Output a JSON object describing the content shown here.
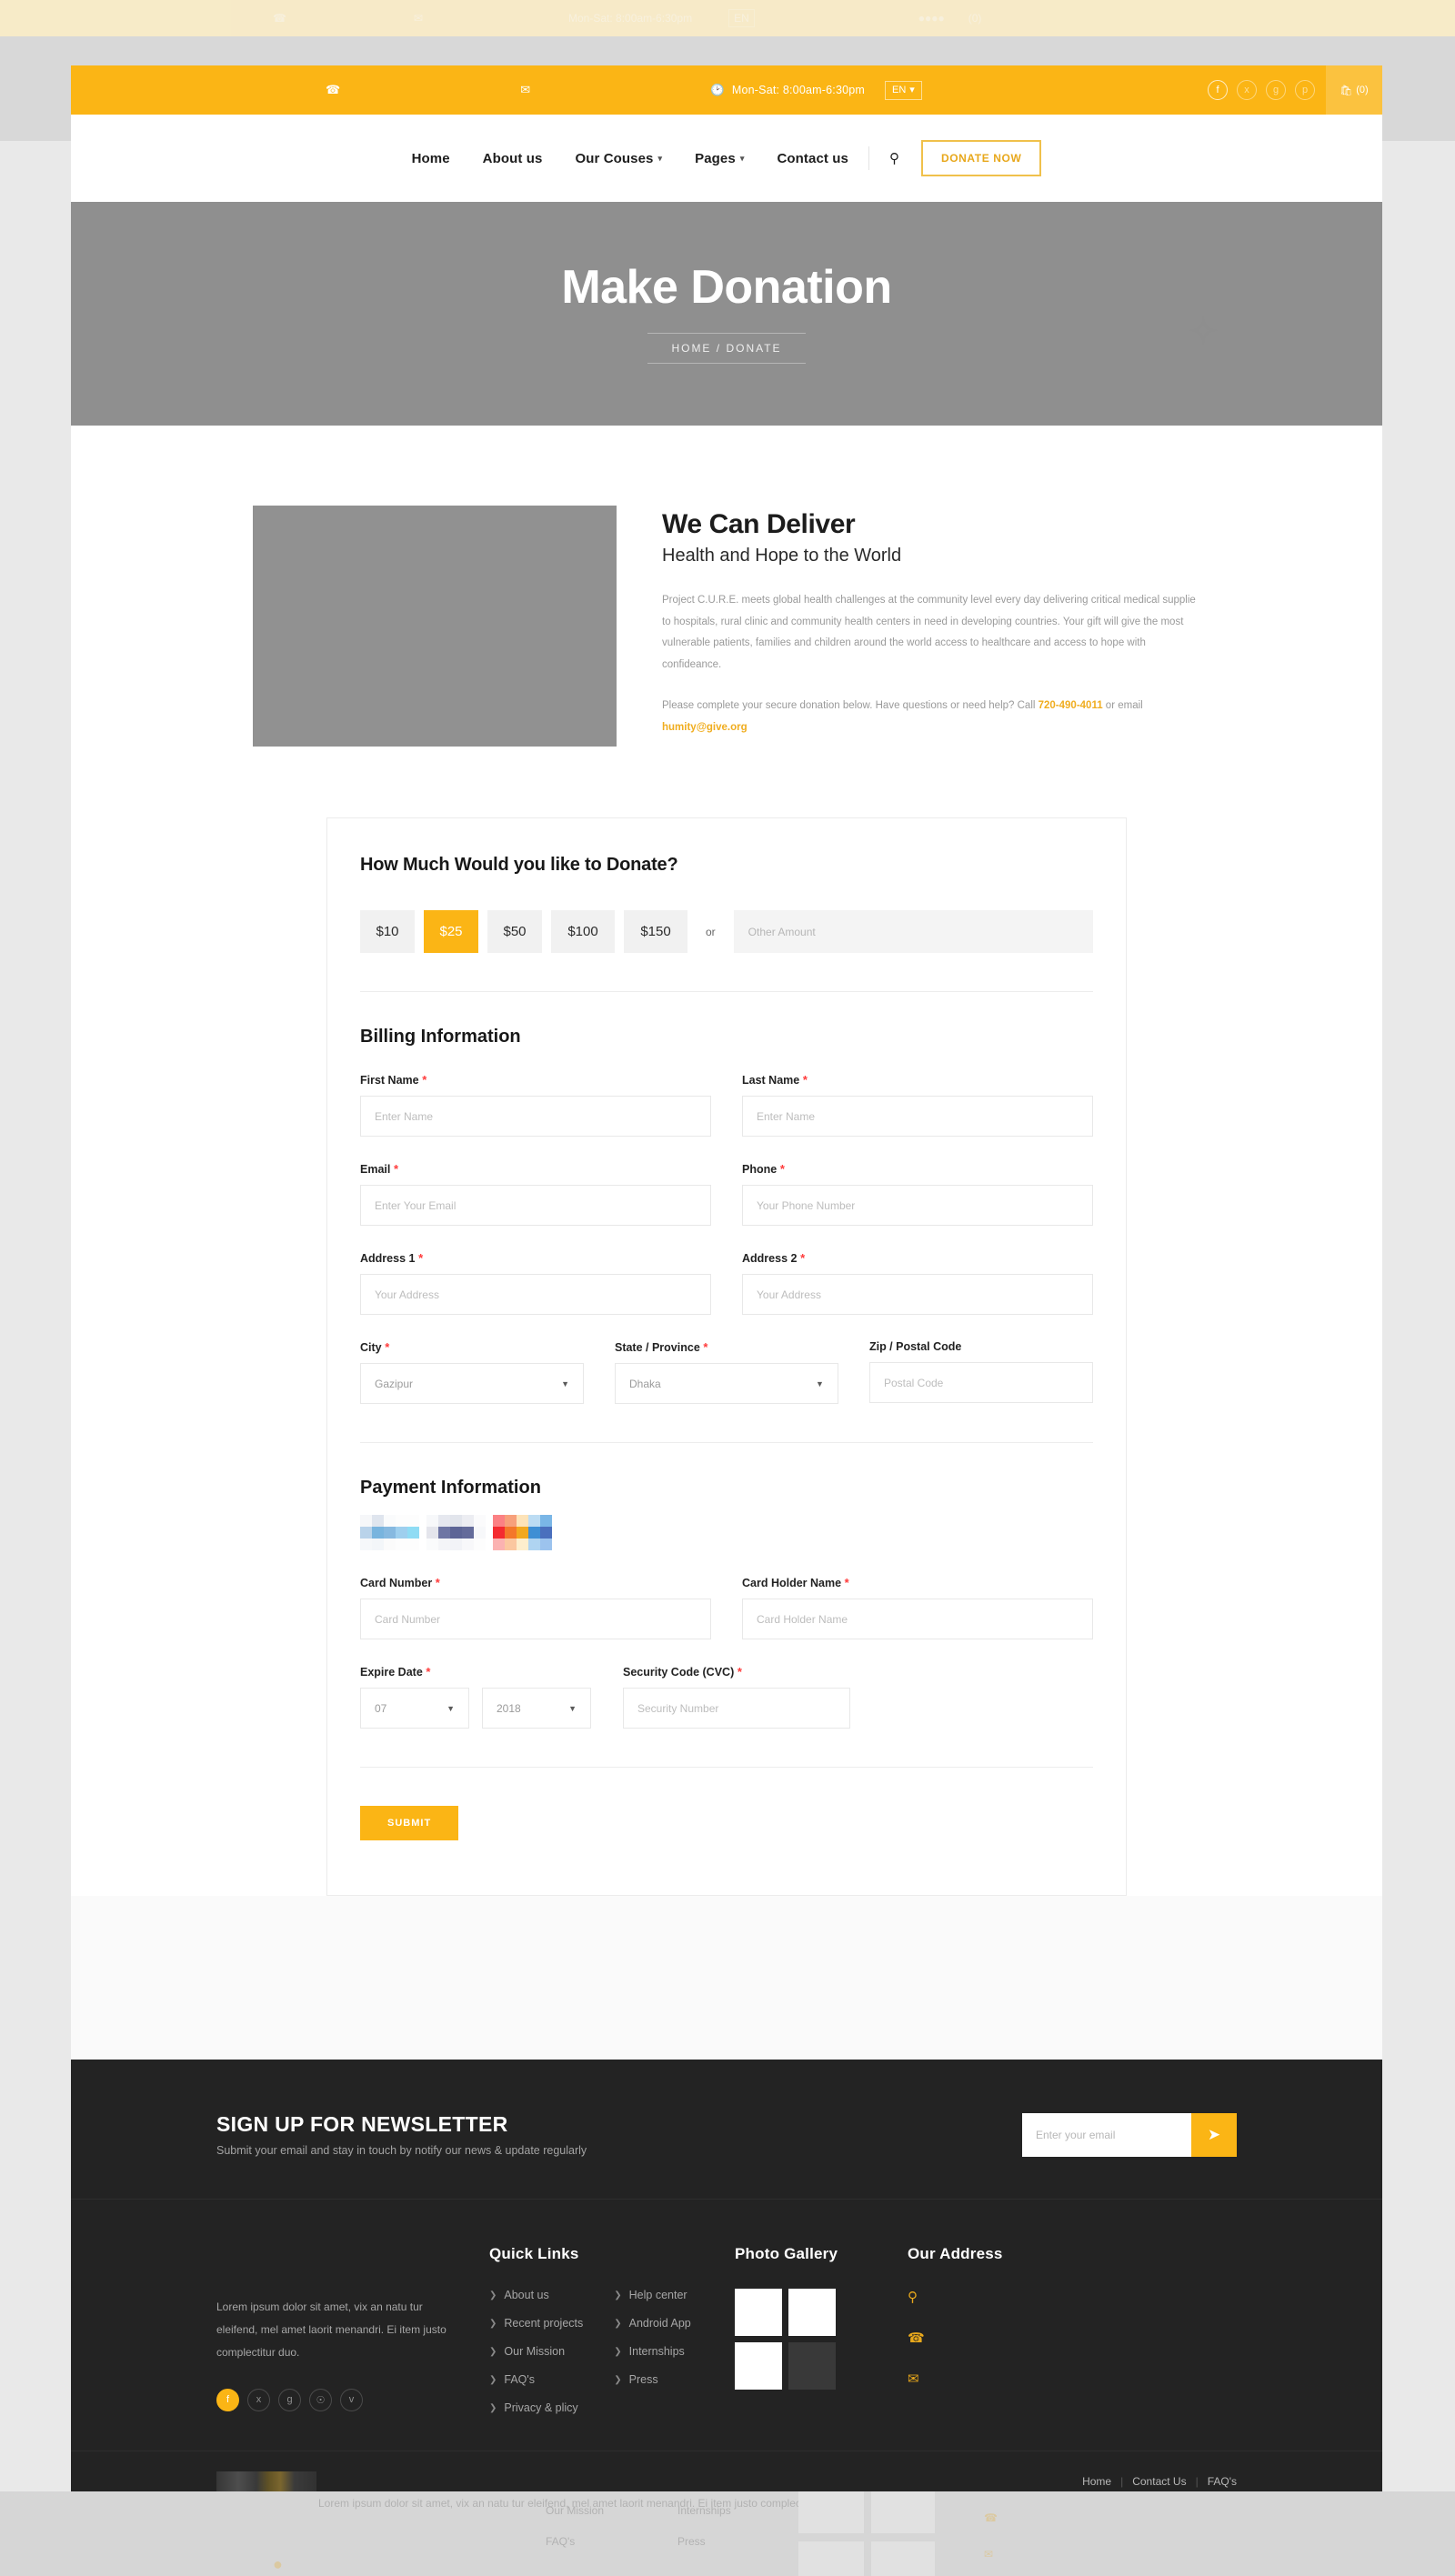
{
  "topbar": {
    "phone_icon": "phone-icon",
    "phone_text": "",
    "mail_icon": "envelope-icon",
    "mail_text": "",
    "clock_icon": "clock-icon",
    "hours": "Mon-Sat: 8:00am-6:30pm",
    "lang": "EN",
    "social": [
      "f",
      "t",
      "g+",
      "p"
    ],
    "cart_icon": "bag-icon",
    "cart_count": "(0)",
    "bg_color": "#fbb515"
  },
  "nav": {
    "items": [
      {
        "label": "Home",
        "has_caret": false
      },
      {
        "label": "About us",
        "has_caret": false
      },
      {
        "label": "Our Couses",
        "has_caret": true
      },
      {
        "label": "Pages",
        "has_caret": true
      },
      {
        "label": "Contact us",
        "has_caret": false
      }
    ],
    "search_icon": "search-icon",
    "donate_label": "DONATE NOW",
    "accent_color": "#e8a81c"
  },
  "hero": {
    "title": "Make Donation",
    "breadcrumb": "HOME / DONATE"
  },
  "intro": {
    "heading": "We Can Deliver",
    "subheading": "Health and Hope to the World",
    "body": "Project C.U.R.E. meets global health challenges at the community level every day delivering critical medical supplie to hospitals, rural clinic and community health centers in need in developing countries. Your gift will give the most vulnerable patients, families and children around the world access to healthcare and access to hope with confideance.",
    "contact_pre": "Please complete your secure donation below. Have questions or need help? Call ",
    "contact_phone": "720-490-4011",
    "contact_mid": " or email ",
    "contact_email": "humity@give.org"
  },
  "donation": {
    "title": "How Much Would you like to Donate?",
    "amounts": [
      "$10",
      "$25",
      "$50",
      "$100",
      "$150"
    ],
    "selected_amount": "$25",
    "or_label": "or",
    "other_placeholder": "Other Amount",
    "other_value": "",
    "active_color": "#fbb515"
  },
  "billing": {
    "title": "Billing Information",
    "fields": [
      {
        "label": "First Name",
        "required": true,
        "placeholder": "Enter Name",
        "value": "",
        "type": "text"
      },
      {
        "label": "Last Name",
        "required": true,
        "placeholder": "Enter Name",
        "value": "",
        "type": "text"
      },
      {
        "label": "Email",
        "required": true,
        "placeholder": "Enter Your Email",
        "value": "",
        "type": "text"
      },
      {
        "label": "Phone",
        "required": true,
        "placeholder": "Your Phone Number",
        "value": "",
        "type": "text"
      },
      {
        "label": "Address 1",
        "required": true,
        "placeholder": "Your Address",
        "value": "",
        "type": "text"
      },
      {
        "label": "Address 2",
        "required": true,
        "placeholder": "Your Address",
        "value": "",
        "type": "text"
      },
      {
        "label": "City",
        "required": true,
        "placeholder": "",
        "value": "Gazipur",
        "type": "select"
      },
      {
        "label": "State / Province",
        "required": true,
        "placeholder": "",
        "value": "Dhaka",
        "type": "select"
      },
      {
        "label": "Zip / Postal Code",
        "required": false,
        "placeholder": "Postal Code",
        "value": "",
        "type": "text"
      }
    ]
  },
  "payment": {
    "title": "Payment Information",
    "card_logos": [
      "card-logo-1",
      "card-logo-2",
      "card-logo-3"
    ],
    "card_number_label": "Card Number",
    "card_number_placeholder": "Card Number",
    "card_number_value": "",
    "card_holder_label": "Card Holder Name",
    "card_holder_placeholder": "Card Holder Name",
    "card_holder_value": "",
    "expire_label": "Expire Date",
    "expire_month": "07",
    "expire_year": "2018",
    "cvc_label": "Security Code (CVC)",
    "cvc_placeholder": "Security Number",
    "cvc_value": "",
    "submit_label": "SUBMIT"
  },
  "newsletter": {
    "title": "SIGN UP FOR NEWSLETTER",
    "subtitle": "Submit your email and stay in touch by notify our news & update regularly",
    "placeholder": "Enter your email",
    "value": "",
    "send_icon": "paper-plane-icon",
    "button_color": "#fbb515"
  },
  "footer": {
    "about_text": "Lorem ipsum dolor sit amet, vix an natu tur eleifend, mel amet laorit menandri. Ei item justo complectitur duo.",
    "social": [
      {
        "icon": "facebook-icon",
        "glyph": "f",
        "active": true
      },
      {
        "icon": "twitter-icon",
        "glyph": "t",
        "active": false
      },
      {
        "icon": "google-plus-icon",
        "glyph": "g+",
        "active": false
      },
      {
        "icon": "pinterest-icon",
        "glyph": "p",
        "active": false
      },
      {
        "icon": "vimeo-icon",
        "glyph": "v",
        "active": false
      }
    ],
    "quick_links_title": "Quick Links",
    "quick_links_col1": [
      "About us",
      "Recent projects",
      "Our Mission",
      "FAQ's",
      "Privacy & plicy"
    ],
    "quick_links_col2": [
      "Help center",
      "Android App",
      "Internships",
      "Press"
    ],
    "gallery_title": "Photo Gallery",
    "gallery_cells": [
      "gallery-thumb-1",
      "gallery-thumb-2",
      "gallery-thumb-3",
      "gallery-thumb-4"
    ],
    "address_title": "Our Address",
    "address_items": [
      {
        "icon": "map-pin-icon",
        "text": ""
      },
      {
        "icon": "phone-icon",
        "text": ""
      },
      {
        "icon": "mail-icon",
        "text": ""
      }
    ],
    "bottom_logo": "site-logo",
    "bottom_links": [
      "Home",
      "Contact Us",
      "FAQ's"
    ],
    "bg_color": "#232323"
  }
}
